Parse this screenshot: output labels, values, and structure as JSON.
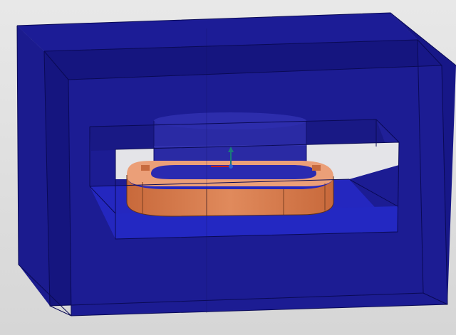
{
  "viewport": {
    "background": "#dcdcdc"
  },
  "model": {
    "housing_colors": {
      "outer_shell": "#1a1a92",
      "shell_dark": "#14147a",
      "shell_edge": "#0a0a55",
      "inner_floor": "#1f24b8",
      "window_light": "#e3e3e6"
    },
    "coil_colors": {
      "coil_face": "#d97a4c",
      "coil_shade": "#c56437",
      "coil_top": "#eda27c",
      "coil_edge": "#6b3a20"
    },
    "core_colors": {
      "core_body": "#2b2ba6",
      "core_edge": "#0f0f60"
    },
    "triad_colors": {
      "axis_z": "#1a7a7a",
      "axis_x": "#c02020",
      "origin": "#2a5fd0"
    }
  }
}
